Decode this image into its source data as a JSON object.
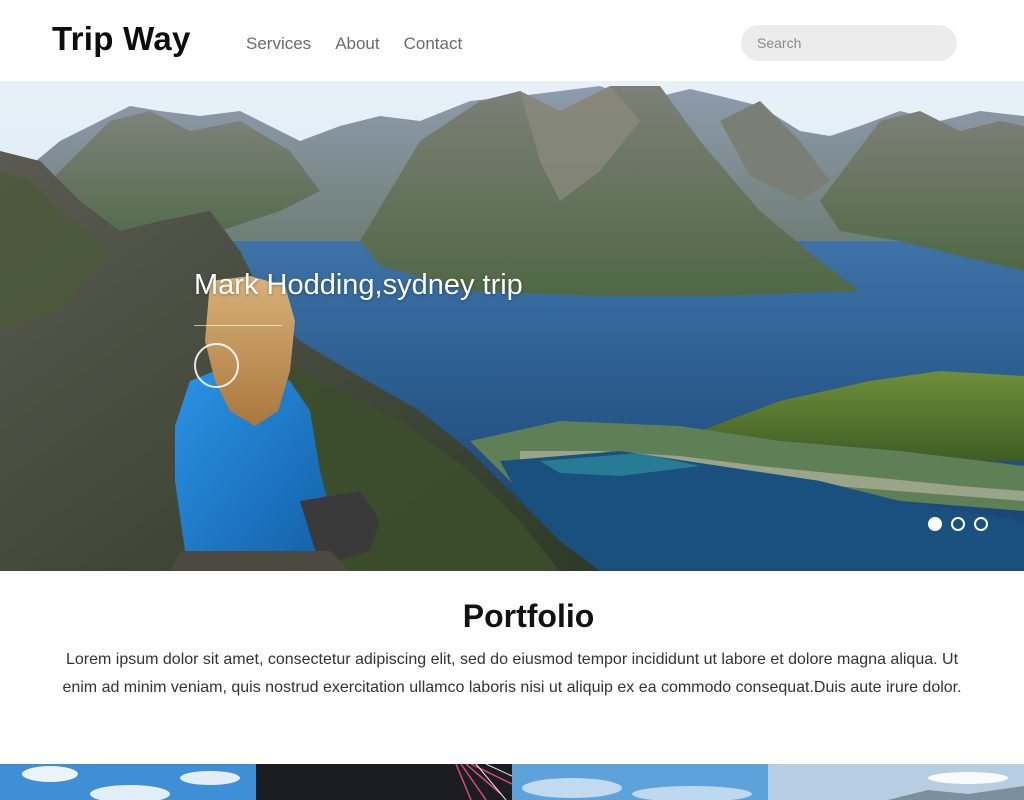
{
  "header": {
    "brand": "Trip Way",
    "nav": [
      "Services",
      "About",
      "Contact"
    ],
    "search_placeholder": "Search"
  },
  "hero": {
    "caption": "Mark Hodding,sydney trip",
    "slides": 3,
    "active_slide": 1
  },
  "portfolio": {
    "title": "Portfolio",
    "text": "Lorem ipsum dolor sit amet, consectetur adipiscing elit, sed do eiusmod tempor incididunt ut labore et dolore magna aliqua. Ut enim ad minim veniam, quis nostrud exercitation ullamco laboris nisi ut aliquip ex ea commodo consequat.Duis aute irure dolor."
  },
  "colors": {
    "sky": "#cfe3f2",
    "lake": "#1f4f86",
    "jacket": "#1e7fd0",
    "search_bg": "#ececec"
  }
}
